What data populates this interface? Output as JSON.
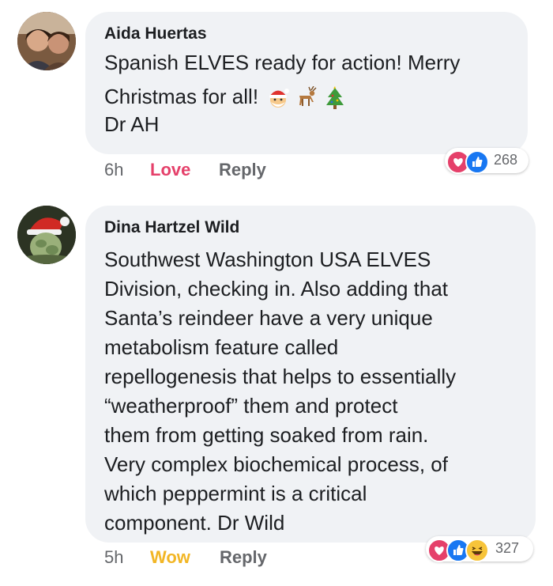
{
  "comments": [
    {
      "author": "Aida Huertas",
      "lines": [
        "Spanish ELVES ready for action! Merry",
        "Christmas for all!",
        "Dr AH"
      ],
      "emojis": [
        "santa-face",
        "deer",
        "christmas-tree"
      ],
      "time": "6h",
      "reaction_action": "Love",
      "reply": "Reply",
      "reaction_types": [
        "love",
        "like"
      ],
      "reaction_count": "268"
    },
    {
      "author": "Dina Hartzel Wild",
      "lines": [
        "Southwest Washington USA ELVES",
        "Division, checking in. Also adding that",
        "Santa’s reindeer have a very unique",
        "metabolism feature called",
        "repellogenesis that helps to essentially",
        "“weatherproof” them and protect",
        "them from getting soaked from rain.",
        "Very complex biochemical process, of",
        "which peppermint is a critical",
        "component. Dr Wild"
      ],
      "time": "5h",
      "reaction_action": "Wow",
      "reply": "Reply",
      "reaction_types": [
        "love",
        "like",
        "haha"
      ],
      "reaction_count": "327"
    }
  ],
  "colors": {
    "bubble": "#f0f2f5",
    "love": "#e5406a",
    "like": "#1877f2",
    "wow": "#f2b625",
    "meta": "#65676b"
  }
}
